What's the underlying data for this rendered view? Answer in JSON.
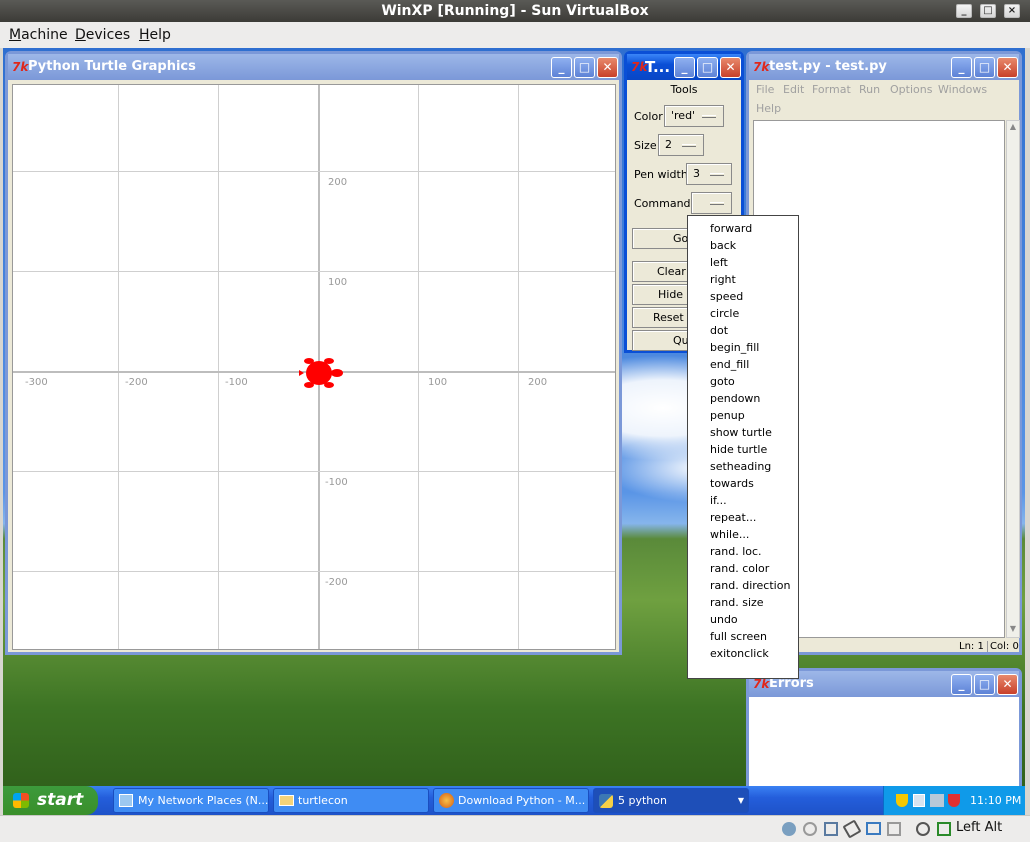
{
  "host": {
    "title": "WinXP [Running] - Sun VirtualBox",
    "menu": [
      "Machine",
      "Devices",
      "Help"
    ],
    "menu_underline": [
      "M",
      "D",
      "H"
    ],
    "menu_rest": [
      "achine",
      "evices",
      "elp"
    ],
    "status_keyboard": "Left Alt"
  },
  "turtle_window": {
    "title": "Python Turtle Graphics",
    "x_ticks": [
      "-300",
      "-200",
      "-100",
      "100",
      "200"
    ],
    "y_ticks": [
      "200",
      "100",
      "-100",
      "-200"
    ],
    "turtle_color": "#ff0000"
  },
  "tools_window": {
    "title": "T...",
    "header": "Tools",
    "color_label": "Color",
    "color_value": "'red'",
    "size_label": "Size",
    "size_value": "2",
    "pen_label": "Pen width",
    "pen_value": "3",
    "commands_label": "Commands",
    "buttons": [
      "Go!",
      "Clear c",
      "Hide C",
      "Reset T",
      "Qui"
    ]
  },
  "idle_window": {
    "title": "test.py - test.py",
    "menu": [
      "File",
      "Edit",
      "Format",
      "Run",
      "Options",
      "Windows",
      "Help"
    ],
    "status_ln": "Ln: 1",
    "status_col": "Col: 0"
  },
  "errors_window": {
    "title": "Errors"
  },
  "commands_menu": [
    "forward",
    "back",
    "left",
    "right",
    "speed",
    "circle",
    "dot",
    "begin_fill",
    "end_fill",
    "goto",
    "pendown",
    "penup",
    "show turtle",
    "hide turtle",
    "setheading",
    "towards",
    "if...",
    "repeat...",
    "while...",
    "rand. loc.",
    "rand. color",
    "rand. direction",
    "rand. size",
    "undo",
    "full screen",
    "exitonclick"
  ],
  "taskbar": {
    "start": "start",
    "tasks": [
      "My Network Places (N...",
      "turtlecon",
      "Download Python - M...",
      "5 python"
    ],
    "clock": "11:10 PM"
  }
}
